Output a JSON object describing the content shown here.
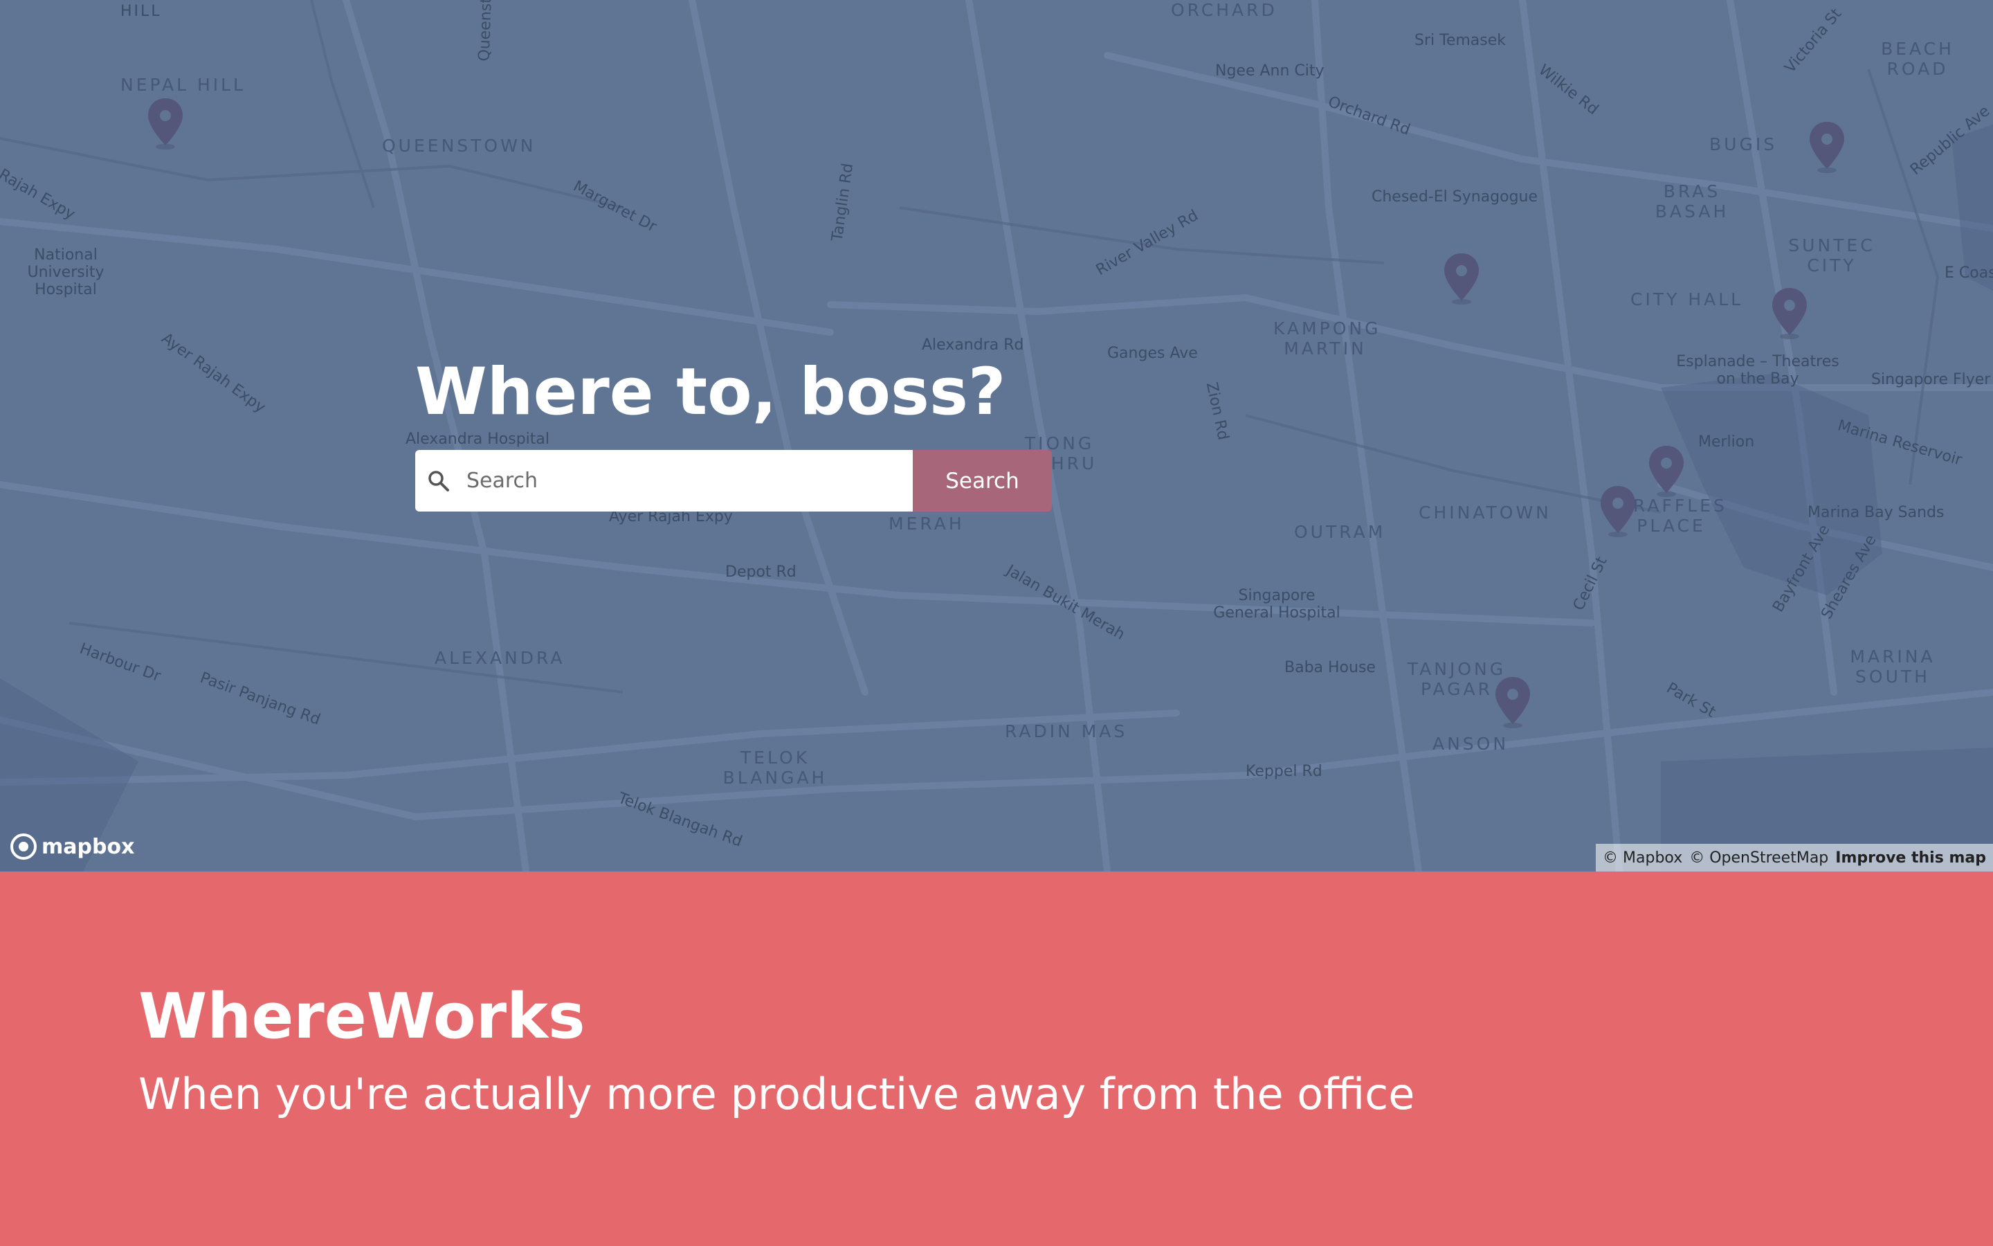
{
  "colors": {
    "map_overlay": "#5f7593",
    "search_button": "#a8667a",
    "footer_background": "#e5696c",
    "pin": "#54577a",
    "text_on_dark": "#ffffff"
  },
  "hero": {
    "title": "Where to, boss?",
    "search_placeholder": "Search",
    "search_button_label": "Search"
  },
  "map": {
    "labels": [
      "HILL",
      "NEPAL HILL",
      "QUEENSTOWN",
      "Queenstown",
      "Margaret Dr",
      "Tanglin Rd",
      "ORCHARD",
      "Sri Temasek",
      "Ngee Ann City",
      "Orchard Rd",
      "Wilkie Rd",
      "Victoria St",
      "BEACH ROAD",
      "BUGIS",
      "Republic Ave",
      "Rajah Expy",
      "National University Hospital",
      "Ayer Rajah Expy",
      "Chesed-El Synagogue",
      "BRAS BASAH",
      "SUNTEC CITY",
      "River Valley Rd",
      "CITY HALL",
      "E Coast",
      "KAMPONG MARTIN",
      "Alexandra Rd",
      "Ganges Ave",
      "Zion Rd",
      "Esplanade – Theatres on the Bay",
      "Singapore Flyer",
      "Marina Reservoir",
      "Alexandra Hospital",
      "TIONG BAHRU",
      "Merlion",
      "Ayer Rajah Expy",
      "MERAH",
      "OUTRAM",
      "CHINATOWN",
      "RAFFLES PLACE",
      "Marina Bay Sands",
      "Depot Rd",
      "Jalan Bukit Merah",
      "Cecil St",
      "Bayfront Ave",
      "Sheares Ave",
      "Harbour Dr",
      "Pasir Panjang Rd",
      "ALEXANDRA",
      "Singapore General Hospital",
      "Baba House",
      "TANJONG PAGAR",
      "MARINA SOUTH",
      "Park St",
      "RADIN MAS",
      "ANSON",
      "TELOK BLANGAH",
      "Keppel Rd",
      "Telok Blangah Rd"
    ],
    "pin_icon": "map-pin-icon",
    "logo_text": "mapbox",
    "attribution": {
      "mapbox": "© Mapbox",
      "osm": "© OpenStreetMap",
      "improve": "Improve this map"
    }
  },
  "footer": {
    "brand": "WhereWorks",
    "tagline": "When you're actually more productive away from the office"
  }
}
